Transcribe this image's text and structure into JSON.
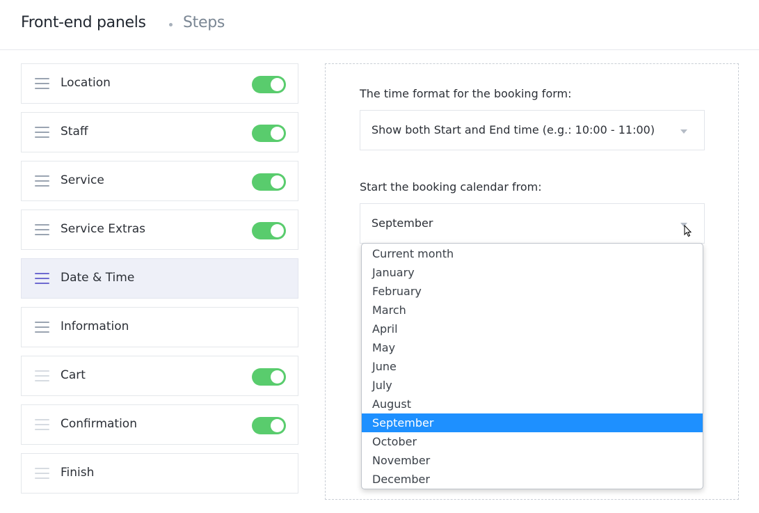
{
  "header": {
    "title": "Front-end panels",
    "subtitle": "Steps"
  },
  "steps": [
    {
      "label": "Location",
      "toggle": true,
      "state": "normal"
    },
    {
      "label": "Staff",
      "toggle": true,
      "state": "normal"
    },
    {
      "label": "Service",
      "toggle": true,
      "state": "normal"
    },
    {
      "label": "Service Extras",
      "toggle": true,
      "state": "normal"
    },
    {
      "label": "Date & Time",
      "toggle": false,
      "state": "active"
    },
    {
      "label": "Information",
      "toggle": false,
      "state": "normal"
    },
    {
      "label": "Cart",
      "toggle": true,
      "state": "faded"
    },
    {
      "label": "Confirmation",
      "toggle": true,
      "state": "faded"
    },
    {
      "label": "Finish",
      "toggle": false,
      "state": "faded"
    }
  ],
  "settings": {
    "time_format": {
      "label": "The time format for the booking form:",
      "value": "Show both Start and End time (e.g.: 10:00 - 11:00)"
    },
    "calendar_start": {
      "label": "Start the booking calendar from:",
      "value": "September",
      "options": [
        "Current month",
        "January",
        "February",
        "March",
        "April",
        "May",
        "June",
        "July",
        "August",
        "September",
        "October",
        "November",
        "December"
      ],
      "selected_index": 9
    }
  },
  "colors": {
    "toggle_on": "#59cc6d",
    "selected_option": "#1e90ff",
    "active_step": "#eef0f8",
    "active_handle": "#6f6bd0"
  }
}
